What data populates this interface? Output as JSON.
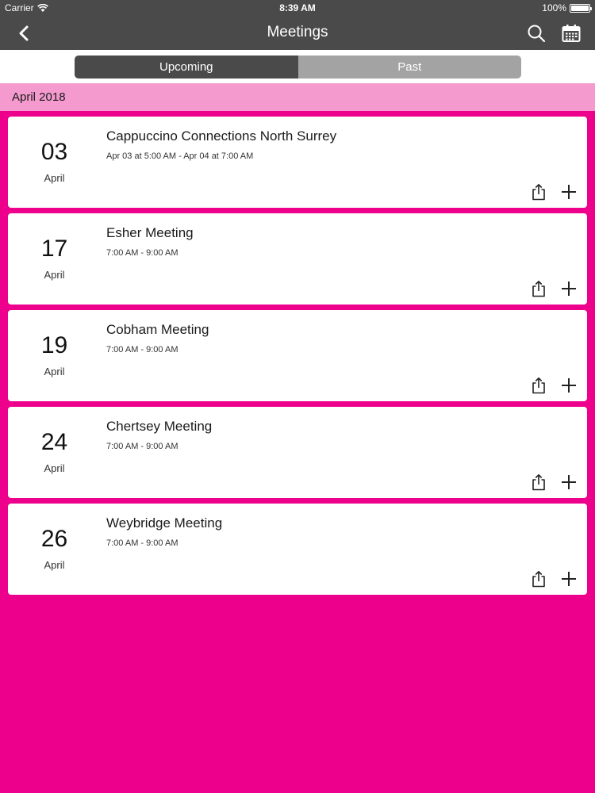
{
  "status_bar": {
    "carrier": "Carrier",
    "time": "8:39 AM",
    "battery": "100%"
  },
  "nav": {
    "title": "Meetings",
    "back_icon": "chevron-left-icon",
    "search_icon": "search-icon",
    "calendar_icon": "calendar-icon"
  },
  "tabs": [
    {
      "label": "Upcoming",
      "active": true
    },
    {
      "label": "Past",
      "active": false
    }
  ],
  "section": {
    "label": "April 2018"
  },
  "meetings": [
    {
      "day": "03",
      "month": "April",
      "name": "Cappuccino Connections North Surrey",
      "time": "Apr 03 at 5:00 AM - Apr 04 at 7:00 AM"
    },
    {
      "day": "17",
      "month": "April",
      "name": "Esher Meeting",
      "time": "7:00 AM - 9:00 AM"
    },
    {
      "day": "19",
      "month": "April",
      "name": "Cobham Meeting",
      "time": "7:00 AM - 9:00 AM"
    },
    {
      "day": "24",
      "month": "April",
      "name": "Chertsey Meeting",
      "time": "7:00 AM - 9:00 AM"
    },
    {
      "day": "26",
      "month": "April",
      "name": "Weybridge Meeting",
      "time": "7:00 AM - 9:00 AM"
    }
  ],
  "colors": {
    "background": "#ec008c",
    "section_header": "#f49ace",
    "navbar": "#4a4a4a",
    "tab_active": "#4a4a4a",
    "tab_inactive": "#a3a3a3"
  }
}
